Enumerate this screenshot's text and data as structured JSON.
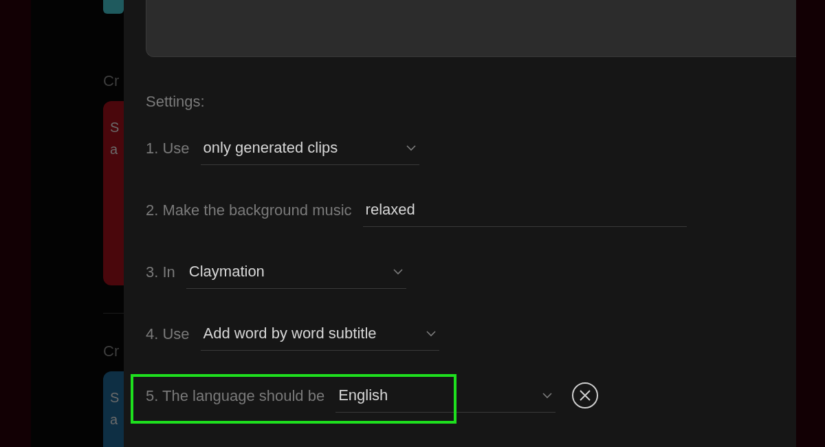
{
  "background": {
    "top_card": {
      "color": "#1f5a5e"
    },
    "sections": [
      {
        "heading": "Cr",
        "card": {
          "color": "#4a070c",
          "lines": [
            "S",
            "a"
          ]
        }
      },
      {
        "heading": "Cr",
        "card": {
          "color": "#0e2f44",
          "lines": [
            "S",
            "a"
          ]
        }
      }
    ]
  },
  "dialog": {
    "prompt_box": {
      "kind": "textarea"
    },
    "settings_title": "Settings:",
    "settings": [
      {
        "kind": "select",
        "label": "1. Use",
        "value": "only generated clips",
        "highlighted": false,
        "removable": false
      },
      {
        "kind": "text",
        "label": "2. Make the background music",
        "value": "relaxed",
        "highlighted": false,
        "removable": false
      },
      {
        "kind": "select",
        "label": "3. In",
        "value": "Claymation",
        "highlighted": false,
        "removable": false
      },
      {
        "kind": "select",
        "label": "4. Use",
        "value": "Add word by word subtitle",
        "highlighted": false,
        "removable": false
      },
      {
        "kind": "select",
        "label": "5. The language should be",
        "value": "English",
        "highlighted": true,
        "removable": true
      }
    ]
  }
}
